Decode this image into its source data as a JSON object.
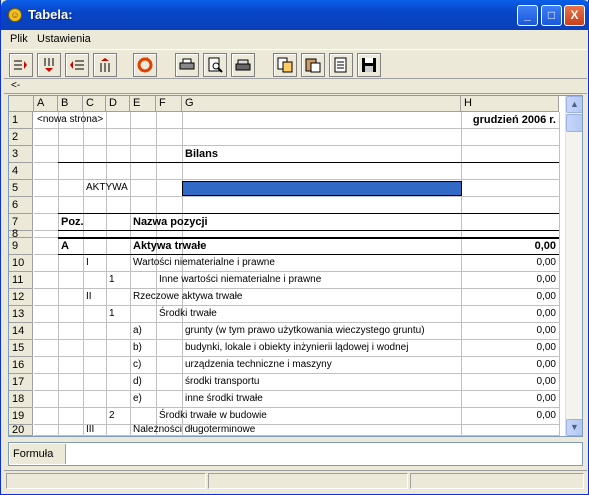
{
  "window": {
    "title": "Tabela:",
    "min": "_",
    "max": "□",
    "close": "X"
  },
  "menu": [
    {
      "label": "Plik"
    },
    {
      "label": "Ustawienia"
    }
  ],
  "toolbar": {
    "buttons": [
      "insert-row-icon",
      "insert-col-icon",
      "delete-row-icon",
      "delete-col-icon",
      "refresh-icon",
      "print-icon",
      "preview-icon",
      "print-setup-icon",
      "copy-icon",
      "paste-icon",
      "import-icon",
      "save-icon"
    ]
  },
  "nav_arrow": "<-",
  "columns": [
    "A",
    "B",
    "C",
    "D",
    "E",
    "F",
    "G",
    "H"
  ],
  "rows": [
    {
      "n": "1",
      "cells": [
        {
          "col": "A",
          "text": "<nowa strona>"
        },
        {
          "col": "H",
          "text": "grudzień 2006 r.",
          "bold": true
        }
      ]
    },
    {
      "n": "2",
      "cells": []
    },
    {
      "n": "3",
      "cells": [
        {
          "col": "G",
          "text": "Bilans",
          "bold": true
        }
      ]
    },
    {
      "n": "4",
      "cells": []
    },
    {
      "n": "5",
      "cells": [
        {
          "col": "C",
          "text": "AKTYWA"
        }
      ]
    },
    {
      "n": "6",
      "cells": []
    },
    {
      "n": "7",
      "cells": [
        {
          "col": "B",
          "text": "Poz.",
          "bold": true
        },
        {
          "col": "E",
          "text": "Nazwa pozycji",
          "bold": true
        }
      ]
    },
    {
      "n": "8",
      "cells": []
    },
    {
      "n": "9",
      "cells": [
        {
          "col": "B",
          "text": "A",
          "bold": true
        },
        {
          "col": "E",
          "text": "Aktywa trwałe",
          "bold": true
        },
        {
          "col": "H",
          "text": "0,00",
          "bold": true
        }
      ]
    },
    {
      "n": "10",
      "cells": [
        {
          "col": "C",
          "text": "I"
        },
        {
          "col": "E",
          "text": "Wartości niematerialne i prawne"
        },
        {
          "col": "H",
          "text": "0,00"
        }
      ]
    },
    {
      "n": "11",
      "cells": [
        {
          "col": "D",
          "text": "1"
        },
        {
          "col": "F",
          "text": "Inne wartości niematerialne i prawne"
        },
        {
          "col": "H",
          "text": "0,00"
        }
      ]
    },
    {
      "n": "12",
      "cells": [
        {
          "col": "C",
          "text": "II"
        },
        {
          "col": "E",
          "text": "Rzeczowe aktywa trwałe"
        },
        {
          "col": "H",
          "text": "0,00"
        }
      ]
    },
    {
      "n": "13",
      "cells": [
        {
          "col": "D",
          "text": "1"
        },
        {
          "col": "F",
          "text": "Środki trwałe"
        },
        {
          "col": "H",
          "text": "0,00"
        }
      ]
    },
    {
      "n": "14",
      "cells": [
        {
          "col": "E",
          "text": "a)"
        },
        {
          "col": "G",
          "text": "grunty (w tym prawo użytkowania wieczystego gruntu)"
        },
        {
          "col": "H",
          "text": "0,00"
        }
      ]
    },
    {
      "n": "15",
      "cells": [
        {
          "col": "E",
          "text": "b)"
        },
        {
          "col": "G",
          "text": "budynki, lokale i obiekty inżynierii lądowej i wodnej"
        },
        {
          "col": "H",
          "text": "0,00"
        }
      ]
    },
    {
      "n": "16",
      "cells": [
        {
          "col": "E",
          "text": "c)"
        },
        {
          "col": "G",
          "text": "urządzenia techniczne i maszyny"
        },
        {
          "col": "H",
          "text": "0,00"
        }
      ]
    },
    {
      "n": "17",
      "cells": [
        {
          "col": "E",
          "text": "d)"
        },
        {
          "col": "G",
          "text": "środki transportu"
        },
        {
          "col": "H",
          "text": "0,00"
        }
      ]
    },
    {
      "n": "18",
      "cells": [
        {
          "col": "E",
          "text": "e)"
        },
        {
          "col": "G",
          "text": "inne środki trwałe"
        },
        {
          "col": "H",
          "text": "0,00"
        }
      ]
    },
    {
      "n": "19",
      "cells": [
        {
          "col": "D",
          "text": "2"
        },
        {
          "col": "F",
          "text": "Środki trwałe w budowie"
        },
        {
          "col": "H",
          "text": "0,00"
        }
      ]
    },
    {
      "n": "20",
      "cells": [
        {
          "col": "C",
          "text": "III"
        },
        {
          "col": "E",
          "text": "Należności długoterminowe"
        }
      ]
    }
  ],
  "formula": {
    "label": "Formuła",
    "value": ""
  },
  "colors": {
    "selection": "#3169c6",
    "titlebar": "#0a5fe8"
  }
}
